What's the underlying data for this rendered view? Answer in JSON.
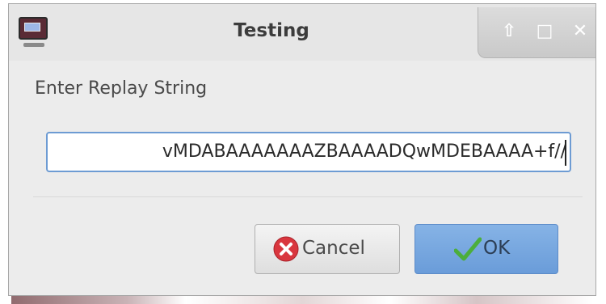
{
  "window": {
    "title": "Testing",
    "controls": {
      "restore_glyph": "⇧",
      "maximize_glyph": "□",
      "close_glyph": "✕"
    }
  },
  "form": {
    "label": "Enter Replay String",
    "input_value": "vMDABAAAAAAAZBAAAADQwMDEBAAAA+f//"
  },
  "buttons": {
    "cancel_label": "Cancel",
    "ok_label": "OK"
  },
  "colors": {
    "accent": "#6a9cd9",
    "cancel_icon": "#d9363e",
    "ok_icon": "#4cae3c"
  }
}
